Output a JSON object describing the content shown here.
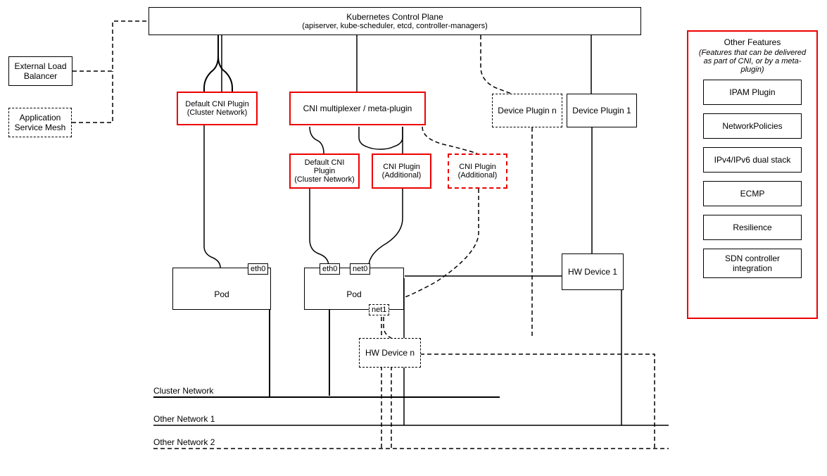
{
  "controlPlane": {
    "title": "Kubernetes Control Plane",
    "subtitle": "(apiserver, kube-scheduler, etcd, controller-managers)"
  },
  "externalLB": "External Load Balancer",
  "appMesh": "Application Service Mesh",
  "defaultCNI_left": {
    "l1": "Default CNI Plugin",
    "l2": "(Cluster Network)"
  },
  "multiplexer": "CNI multiplexer / meta-plugin",
  "defaultCNI_mid": {
    "l1": "Default CNI Plugin",
    "l2": "(Cluster Network)"
  },
  "cniAdd1": {
    "l1": "CNI Plugin",
    "l2": "(Additional)"
  },
  "cniAdd2": {
    "l1": "CNI Plugin",
    "l2": "(Additional)"
  },
  "devicePluginN": "Device Plugin n",
  "devicePlugin1": "Device Plugin 1",
  "podLeft": "Pod",
  "podMid": "Pod",
  "eth0": "eth0",
  "net0": "net0",
  "net1": "net1",
  "hwDevice1": "HW Device 1",
  "hwDeviceN": "HW Device n",
  "clusterNetwork": "Cluster Network",
  "otherNet1": "Other Network 1",
  "otherNet2": "Other Network 2",
  "features": {
    "title": "Other Features",
    "subtitle": "(Features that can be delivered as part of CNI, or by a meta-plugin)",
    "items": [
      "IPAM Plugin",
      "NetworkPolicies",
      "IPv4/IPv6 dual stack",
      "ECMP",
      "Resilience",
      "SDN controller integration"
    ]
  }
}
